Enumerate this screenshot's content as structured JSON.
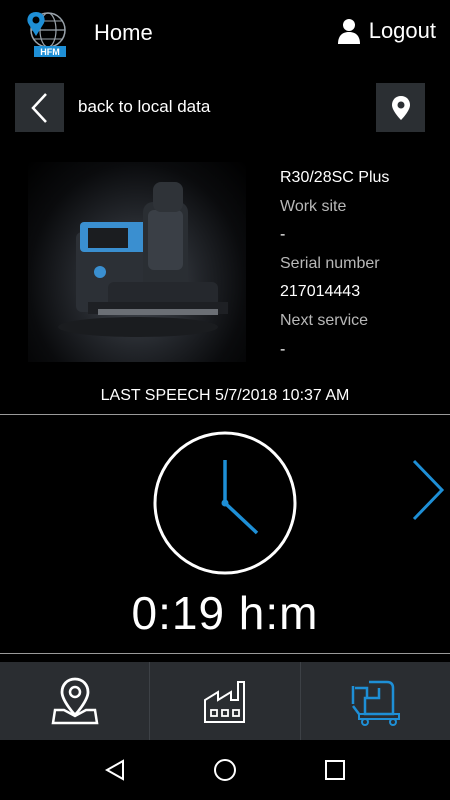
{
  "header": {
    "logo_text": "HFM",
    "title": "Home",
    "logout_label": "Logout"
  },
  "backbar": {
    "back_label": "back to local data"
  },
  "machine": {
    "model": "R30/28SC Plus",
    "work_site_label": "Work site",
    "work_site_value": "-",
    "serial_label": "Serial number",
    "serial_value": "217014443",
    "next_service_label": "Next service",
    "next_service_value": "-"
  },
  "status": {
    "last_speech": "LAST SPEECH 5/7/2018 10:37 AM",
    "hours": "0:19 h:m"
  },
  "tabs": [
    {
      "icon": "map-pin-icon",
      "active": false
    },
    {
      "icon": "factory-icon",
      "active": false
    },
    {
      "icon": "scrubber-machine-icon",
      "active": true
    }
  ],
  "colors": {
    "accent": "#1e8fd6",
    "button_bg": "#2b2f33",
    "tabbar_bg": "#2a2d31"
  }
}
